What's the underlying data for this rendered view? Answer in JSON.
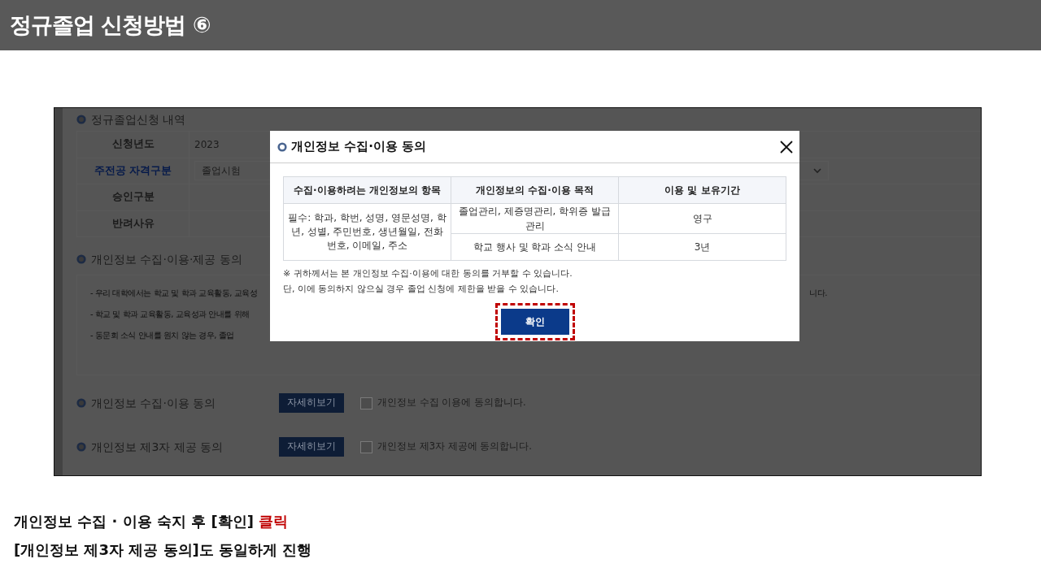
{
  "slide_title": "정규졸업 신청방법 ⑥",
  "page": {
    "application": {
      "heading": "정규졸업신청 내역",
      "rows": [
        {
          "label": "신청년도",
          "kind": "text",
          "value": "2023",
          "color": "#1a1a1a"
        },
        {
          "label": "주전공 자격구분",
          "kind": "select",
          "value": "졸업시험",
          "color": "#061a4a"
        },
        {
          "label": "승인구분",
          "kind": "text",
          "color": "#1a1a1a"
        },
        {
          "label": "반려사유",
          "kind": "text",
          "color": "#1a1a1a"
        }
      ]
    },
    "consent": {
      "heading": "개인정보 수집·이용·제공 동의",
      "lines": [
        {
          "text": "- 우리 대학에서는 학교 및 학과 교육활동, 교육성",
          "tail": "니다."
        },
        {
          "text": "- 학교 및 학과 교육활동, 교육성과 안내를 위해"
        },
        {
          "text": "- 동문회 소식 안내를 원치 않는 경우, 졸업"
        }
      ]
    },
    "agreements": [
      {
        "heading": "개인정보 수집·이용 동의",
        "button": "자세히보기",
        "checked": false,
        "label": "개인정보 수집 이용에 동의합니다."
      },
      {
        "heading": "개인정보 제3자 제공 동의",
        "button": "자세히보기",
        "checked": false,
        "label": "개인정보 제3자 제공에 동의합니다."
      }
    ]
  },
  "dialog": {
    "title": "개인정보 수집·이용 동의",
    "columns": [
      "수집·이용하려는 개인정보의 항목",
      "개인정보의 수집·이용 목적",
      "이용 및 보유기간"
    ],
    "items": "필수: 학과, 학번, 성명, 영문성명, 학년, 성별, 주민번호, 생년월일, 전화번호, 이메일, 주소",
    "rows": [
      {
        "purpose": "졸업관리, 제증명관리, 학위증 발급관리",
        "period": "영구"
      },
      {
        "purpose": "학교 행사 및 학과 소식 안내",
        "period": "3년"
      }
    ],
    "notes": [
      "※ 귀하께서는 본 개인정보 수집·이용에 대한 동의를 거부할 수 있습니다.",
      "단, 이에 동의하지 않으실 경우 졸업 신청에 제한을 받을 수 있습니다."
    ],
    "confirm": {
      "label": "확인",
      "highlighted": true
    }
  },
  "caption": [
    {
      "text": "개인정보 수집 · 이용 숙지 후 [확인]",
      "accent": "클릭"
    },
    {
      "text": "[개인정보 제3자 제공 동의]도 동일하게 진행"
    }
  ]
}
